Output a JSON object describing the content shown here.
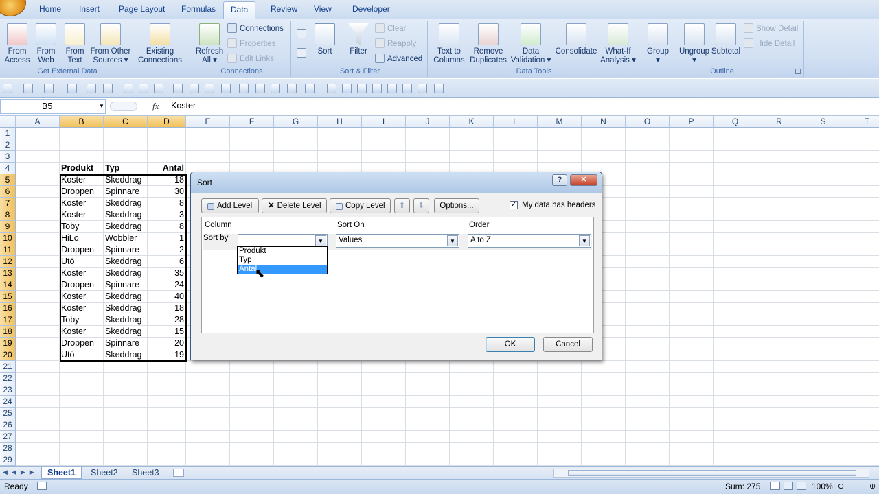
{
  "tabs": [
    "Home",
    "Insert",
    "Page Layout",
    "Formulas",
    "Data",
    "Review",
    "View",
    "Developer"
  ],
  "active_tab": "Data",
  "ribbon": {
    "get_external": {
      "buttons": [
        "From\nAccess",
        "From\nWeb",
        "From\nText",
        "From Other\nSources ▾",
        "Existing\nConnections"
      ],
      "label": "Get External Data"
    },
    "connections": {
      "refresh": "Refresh\nAll ▾",
      "items": [
        "Connections",
        "Properties",
        "Edit Links"
      ],
      "label": "Connections"
    },
    "sort_filter": {
      "sort": "Sort",
      "filter": "Filter",
      "items": [
        "Clear",
        "Reapply",
        "Advanced"
      ],
      "label": "Sort & Filter"
    },
    "data_tools": {
      "buttons": [
        "Text to\nColumns",
        "Remove\nDuplicates",
        "Data\nValidation ▾",
        "Consolidate",
        "What-If\nAnalysis ▾"
      ],
      "label": "Data Tools"
    },
    "outline": {
      "buttons": [
        "Group\n▾",
        "Ungroup\n▾",
        "Subtotal"
      ],
      "items": [
        "Show Detail",
        "Hide Detail"
      ],
      "label": "Outline"
    }
  },
  "formula_bar": {
    "name_box": "B5",
    "fx": "fx",
    "value": "Koster"
  },
  "columns": [
    "A",
    "B",
    "C",
    "D",
    "E",
    "F",
    "G",
    "H",
    "I",
    "J",
    "K",
    "L",
    "M",
    "N",
    "O",
    "P",
    "Q",
    "R",
    "S",
    "T"
  ],
  "rows": [
    "1",
    "2",
    "3",
    "4",
    "5",
    "6",
    "7",
    "8",
    "9",
    "10",
    "11",
    "12",
    "13",
    "14",
    "15",
    "16",
    "17",
    "18",
    "19",
    "20",
    "21",
    "22",
    "23",
    "24",
    "25",
    "26",
    "27",
    "28",
    "29"
  ],
  "table": {
    "headers": [
      "Produkt",
      "Typ",
      "Antal"
    ],
    "rows": [
      [
        "Koster",
        "Skeddrag",
        "18"
      ],
      [
        "Droppen",
        "Spinnare",
        "30"
      ],
      [
        "Koster",
        "Skeddrag",
        "8"
      ],
      [
        "Koster",
        "Skeddrag",
        "3"
      ],
      [
        "Toby",
        "Skeddrag",
        "8"
      ],
      [
        "HiLo",
        "Wobbler",
        "1"
      ],
      [
        "Droppen",
        "Spinnare",
        "2"
      ],
      [
        "Utö",
        "Skeddrag",
        "6"
      ],
      [
        "Koster",
        "Skeddrag",
        "35"
      ],
      [
        "Droppen",
        "Spinnare",
        "24"
      ],
      [
        "Koster",
        "Skeddrag",
        "40"
      ],
      [
        "Koster",
        "Skeddrag",
        "18"
      ],
      [
        "Toby",
        "Skeddrag",
        "28"
      ],
      [
        "Koster",
        "Skeddrag",
        "15"
      ],
      [
        "Droppen",
        "Spinnare",
        "20"
      ],
      [
        "Utö",
        "Skeddrag",
        "19"
      ]
    ]
  },
  "sheets": [
    "Sheet1",
    "Sheet2",
    "Sheet3"
  ],
  "active_sheet": "Sheet1",
  "status": {
    "ready": "Ready",
    "sum": "Sum: 275",
    "zoom": "100%"
  },
  "dialog": {
    "title": "Sort",
    "help": "?",
    "close": "✕",
    "add_level": "Add Level",
    "delete_level": "Delete Level",
    "copy_level": "Copy Level",
    "options": "Options...",
    "headers_checkbox": "My data has headers",
    "col_column": "Column",
    "col_sort_on": "Sort On",
    "col_order": "Order",
    "sort_by": "Sort by",
    "sort_on_value": "Values",
    "order_value": "A to Z",
    "dropdown_options": [
      "Produkt",
      "Typ",
      "Antal"
    ],
    "ok": "OK",
    "cancel": "Cancel"
  }
}
